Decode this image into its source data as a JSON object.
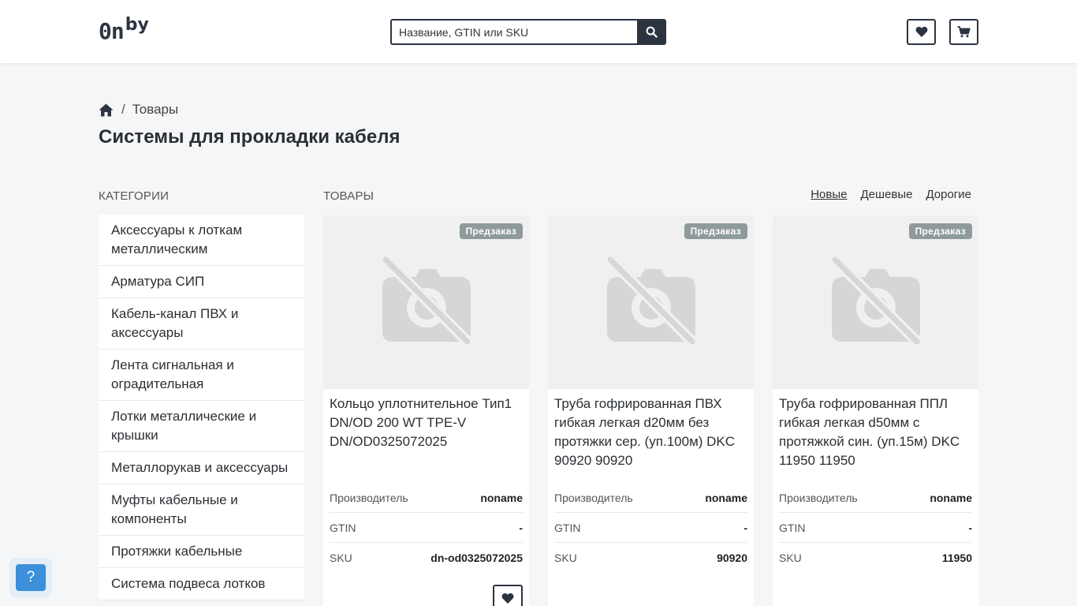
{
  "header": {
    "logo_main": "0n",
    "logo_sup": "by",
    "search_placeholder": "Название, GTIN или SKU"
  },
  "breadcrumb": {
    "separator": "/",
    "current": "Товары"
  },
  "page_title": "Системы для прокладки кабеля",
  "categories": {
    "label": "КАТЕГОРИИ",
    "items": [
      "Аксессуары к лоткам металлическим",
      "Арматура СИП",
      "Кабель-канал ПВХ и аксессуары",
      "Лента сигнальная и оградительная",
      "Лотки металлические и крышки",
      "Металлорукав и аксессуары",
      "Муфты кабельные и компоненты",
      "Протяжки кабельные",
      "Система подвеса лотков"
    ]
  },
  "products": {
    "label": "ТОВАРЫ",
    "sort": [
      "Новые",
      "Дешевые",
      "Дорогие"
    ],
    "items": [
      {
        "badge": "Предзаказ",
        "name": "Кольцо уплотнительное Тип1 DN/OD 200 WT TPE-V DN/OD0325072025",
        "specs": [
          {
            "k": "Производитель",
            "v": "noname"
          },
          {
            "k": "GTIN",
            "v": "-"
          },
          {
            "k": "SKU",
            "v": "dn-od0325072025"
          }
        ]
      },
      {
        "badge": "Предзаказ",
        "name": "Труба гофрированная ПВХ гибкая легкая d20мм без протяжки сер. (уп.100м) DKC 90920 90920",
        "specs": [
          {
            "k": "Производитель",
            "v": "noname"
          },
          {
            "k": "GTIN",
            "v": "-"
          },
          {
            "k": "SKU",
            "v": "90920"
          }
        ]
      },
      {
        "badge": "Предзаказ",
        "name": "Труба гофрированная ППЛ гибкая легкая d50мм с протяжкой син. (уп.15м) DKC 11950 11950",
        "specs": [
          {
            "k": "Производитель",
            "v": "noname"
          },
          {
            "k": "GTIN",
            "v": "-"
          },
          {
            "k": "SKU",
            "v": "11950"
          }
        ]
      }
    ]
  },
  "help": {
    "label": "?"
  },
  "colors": {
    "accent_dark": "#2b3440",
    "badge": "#8f9a9b",
    "help_blue": "#3b8fdb",
    "background": "#f5f6f7"
  },
  "icons": [
    "search-icon",
    "heart-icon",
    "cart-icon",
    "home-icon",
    "no-photo-icon"
  ]
}
